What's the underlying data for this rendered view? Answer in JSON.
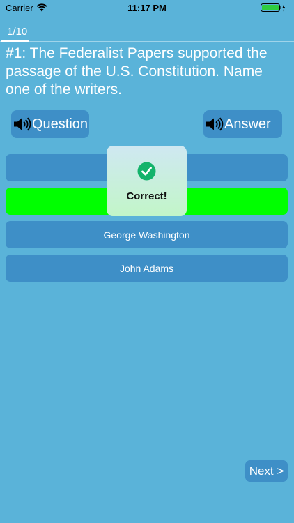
{
  "status_bar": {
    "carrier": "Carrier",
    "time": "11:17 PM",
    "wifi_icon": "wifi-icon",
    "battery_icon": "battery-icon"
  },
  "quiz": {
    "progress": "1/10",
    "question": "#1: The Federalist Papers supported the passage of the U.S. Constitution. Name one of the writers.",
    "audio_buttons": {
      "question_label": "Question",
      "answer_label": "Answer",
      "icon": "speaker-icon"
    },
    "options": [
      {
        "label": ""
      },
      {
        "label": "",
        "state": "correct"
      },
      {
        "label": "George Washington"
      },
      {
        "label": "John Adams"
      }
    ],
    "feedback": {
      "label": "Correct!",
      "icon": "checkmark-icon"
    },
    "next_label": "Next >"
  },
  "colors": {
    "background": "#5ab3d9",
    "button": "#3e8fc7",
    "correct_option": "#00ff00",
    "check_green": "#14b36b"
  }
}
